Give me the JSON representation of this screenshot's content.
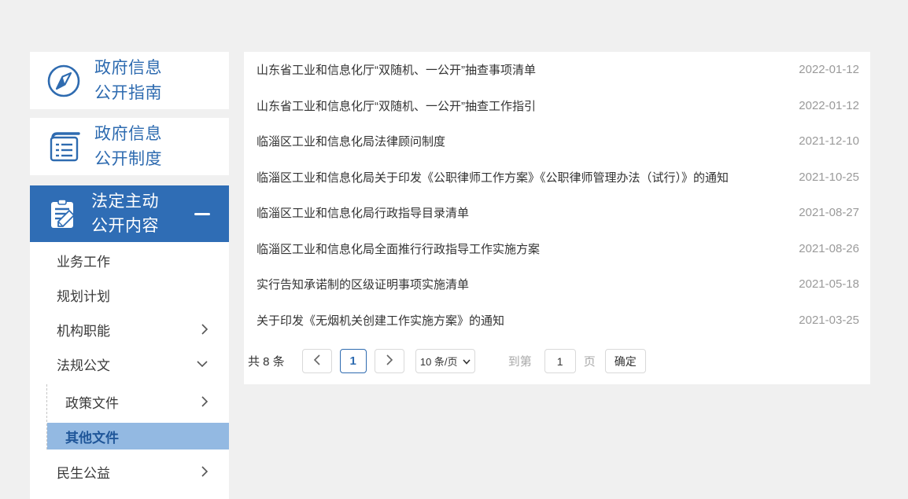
{
  "colors": {
    "accent_blue": "#2f6db5",
    "link_blue": "#2e6bb0",
    "active_item_bg": "#93b9e2",
    "active_item_text": "#1f5699",
    "page_background": "#f0f0f0",
    "list_text": "#333333",
    "date_text": "#9a9a9a"
  },
  "icons": {
    "card1": "compass-icon",
    "card2": "book-lines-icon",
    "section": "clipboard-pencil-icon",
    "collapse": "minus-icon",
    "expand_right": "chevron-right-icon",
    "expand_down": "chevron-down-icon",
    "prev": "chevron-left-icon",
    "next": "chevron-right-icon",
    "select_caret": "caret-down-icon"
  },
  "sidebar": {
    "cards": [
      {
        "icon": "compass-icon",
        "line1": "政府信息",
        "line2": "公开指南"
      },
      {
        "icon": "book-lines-icon",
        "line1": "政府信息",
        "line2": "公开制度"
      }
    ],
    "section": {
      "icon": "clipboard-pencil-icon",
      "line1": "法定主动",
      "line2": "公开内容",
      "collapse_icon": "minus-icon"
    },
    "menu": {
      "items": [
        {
          "label": "业务工作",
          "chevron": "none",
          "sub": false,
          "active": false
        },
        {
          "label": "规划计划",
          "chevron": "none",
          "sub": false,
          "active": false
        },
        {
          "label": "机构职能",
          "chevron": "right",
          "sub": false,
          "active": false
        },
        {
          "label": "法规公文",
          "chevron": "down",
          "sub": false,
          "active": false
        },
        {
          "label": "政策文件",
          "chevron": "right",
          "sub": true,
          "active": false
        },
        {
          "label": "其他文件",
          "chevron": "none",
          "sub": true,
          "active": true
        },
        {
          "label": "民生公益",
          "chevron": "right",
          "sub": false,
          "active": false
        }
      ]
    }
  },
  "list": {
    "items": [
      {
        "title": "山东省工业和信息化厅“双随机、一公开”抽查事项清单",
        "date": "2022-01-12"
      },
      {
        "title": "山东省工业和信息化厅“双随机、一公开”抽查工作指引",
        "date": "2022-01-12"
      },
      {
        "title": "临淄区工业和信息化局法律顾问制度",
        "date": "2021-12-10"
      },
      {
        "title": "临淄区工业和信息化局关于印发《公职律师工作方案》《公职律师管理办法（试行）》的通知",
        "date": "2021-10-25"
      },
      {
        "title": "临淄区工业和信息化局行政指导目录清单",
        "date": "2021-08-27"
      },
      {
        "title": "临淄区工业和信息化局全面推行行政指导工作实施方案",
        "date": "2021-08-26"
      },
      {
        "title": "实行告知承诺制的区级证明事项实施清单",
        "date": "2021-05-18"
      },
      {
        "title": "关于印发《无烟机关创建工作实施方案》的通知",
        "date": "2021-03-25"
      }
    ]
  },
  "pagination": {
    "total_label": "共 8 条",
    "current_page": "1",
    "page_size_label": "10 条/页",
    "goto_prefix": "到第",
    "goto_value": "1",
    "goto_suffix": "页",
    "confirm_label": "确定"
  }
}
